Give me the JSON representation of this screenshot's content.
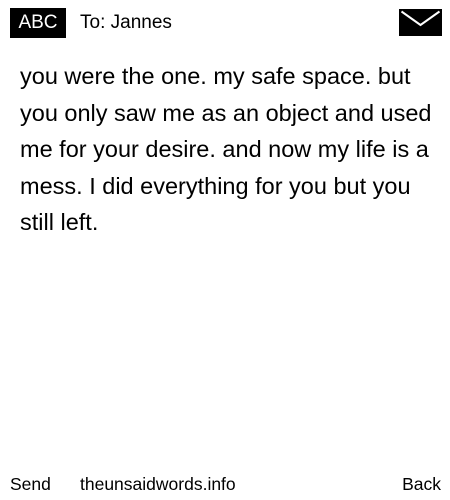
{
  "header": {
    "mode_label": "ABC",
    "recipient": "To: Jannes",
    "icon": "envelope-icon"
  },
  "message": {
    "text": "you were the one. my safe space. but you only saw me as an object and used me for your desire. and now my life is a mess. I did everything for you but you still left."
  },
  "footer": {
    "send_label": "Send",
    "site_label": "theunsaidwords.info",
    "back_label": "Back"
  },
  "colors": {
    "background": "#ffffff",
    "text": "#000000",
    "badge_background": "#000000",
    "badge_text": "#ffffff"
  }
}
